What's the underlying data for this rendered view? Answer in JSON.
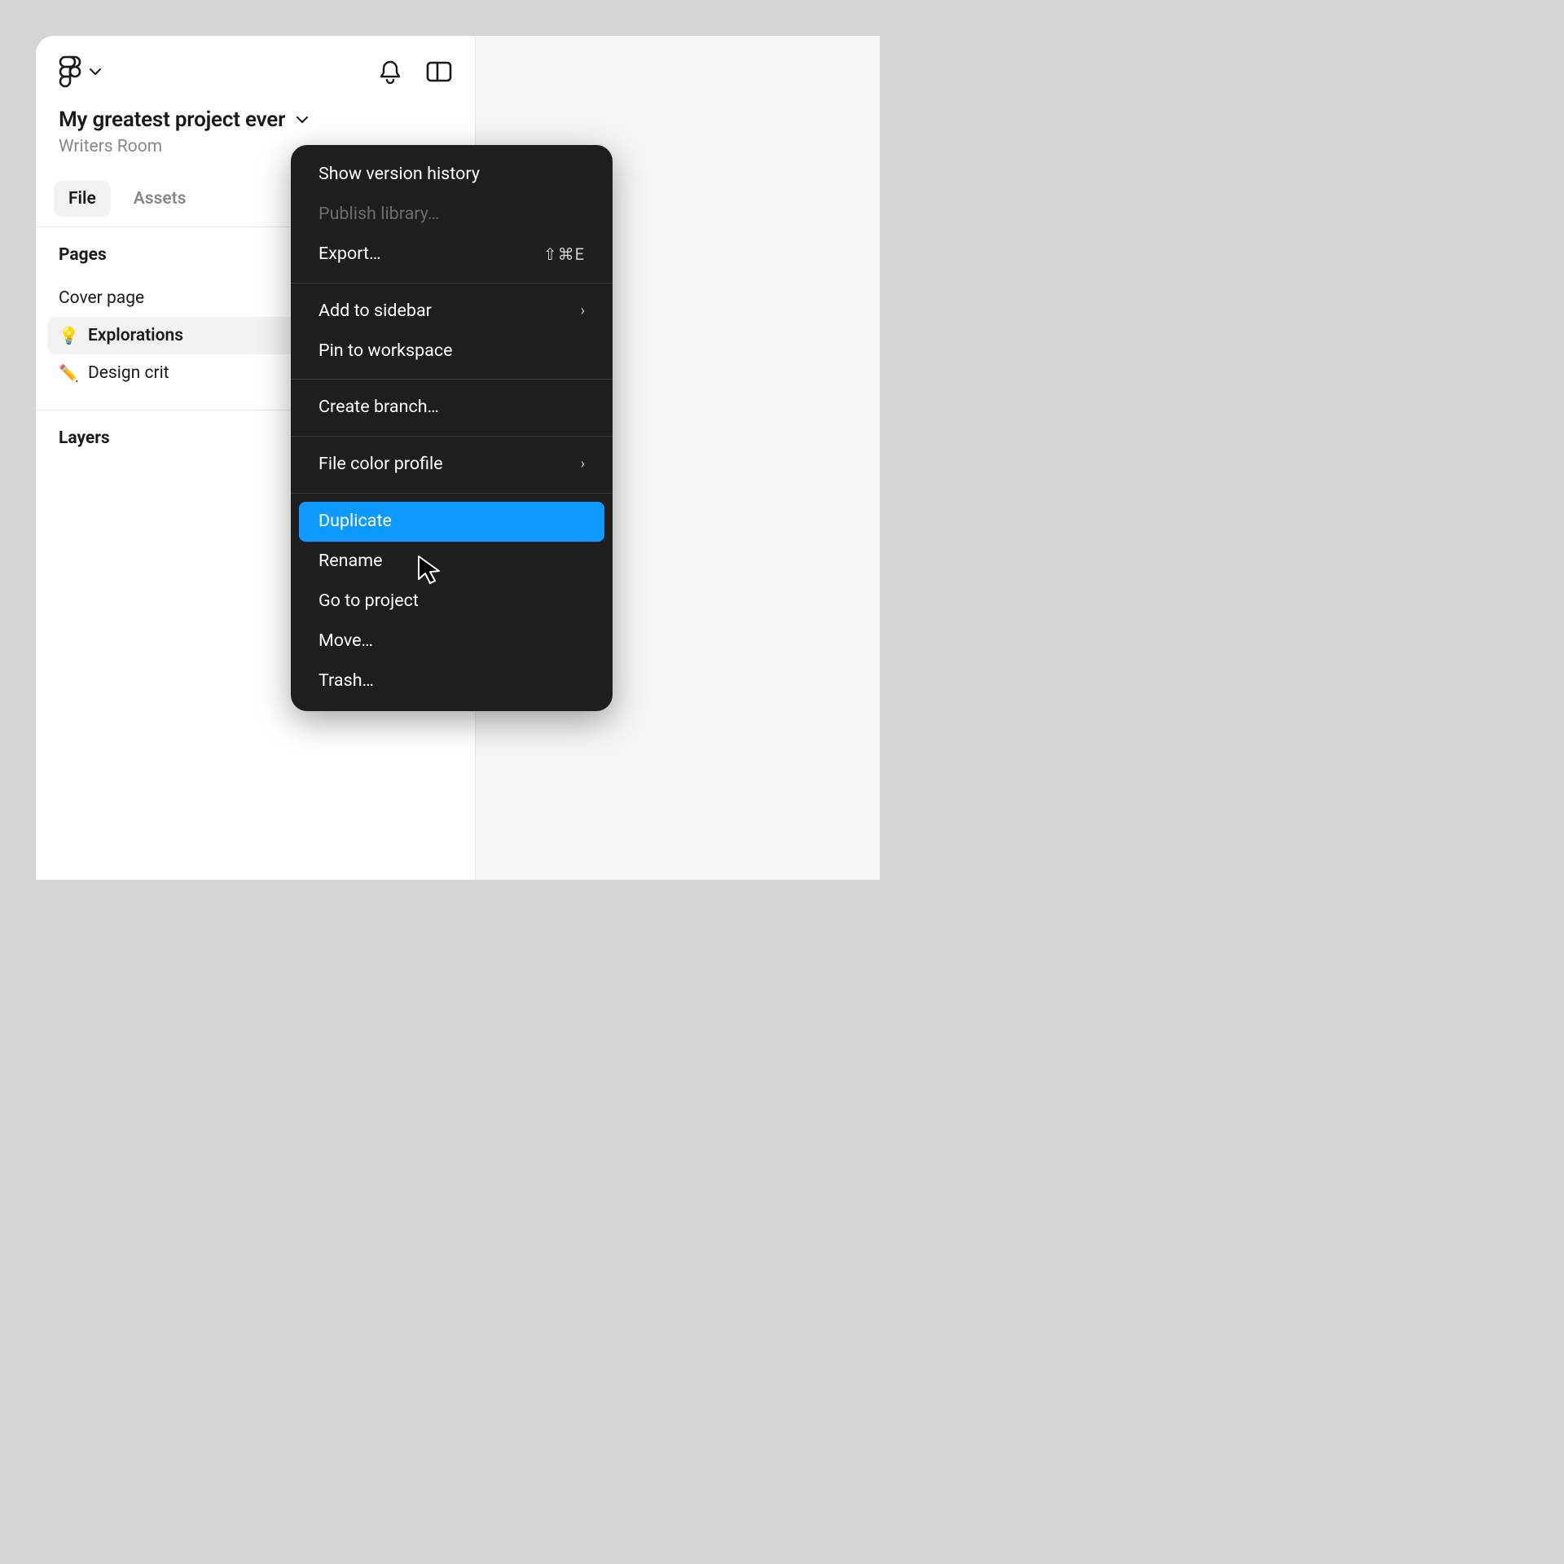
{
  "project": {
    "title": "My greatest project ever",
    "workspace": "Writers Room"
  },
  "tabs": {
    "file": "File",
    "assets": "Assets"
  },
  "pages": {
    "section_title": "Pages",
    "items": [
      {
        "emoji": "",
        "label": "Cover page",
        "active": false
      },
      {
        "emoji": "💡",
        "label": "Explorations",
        "active": true
      },
      {
        "emoji": "✏️",
        "label": "Design crit",
        "active": false
      }
    ]
  },
  "layers": {
    "section_title": "Layers"
  },
  "context_menu": {
    "groups": [
      [
        {
          "label": "Show version history",
          "shortcut": "",
          "submenu": false,
          "disabled": false,
          "hover": false
        },
        {
          "label": "Publish library…",
          "shortcut": "",
          "submenu": false,
          "disabled": true,
          "hover": false
        },
        {
          "label": "Export…",
          "shortcut": "⇧⌘E",
          "submenu": false,
          "disabled": false,
          "hover": false
        }
      ],
      [
        {
          "label": "Add to sidebar",
          "shortcut": "",
          "submenu": true,
          "disabled": false,
          "hover": false
        },
        {
          "label": "Pin to workspace",
          "shortcut": "",
          "submenu": false,
          "disabled": false,
          "hover": false
        }
      ],
      [
        {
          "label": "Create branch…",
          "shortcut": "",
          "submenu": false,
          "disabled": false,
          "hover": false
        }
      ],
      [
        {
          "label": "File color profile",
          "shortcut": "",
          "submenu": true,
          "disabled": false,
          "hover": false
        }
      ],
      [
        {
          "label": "Duplicate",
          "shortcut": "",
          "submenu": false,
          "disabled": false,
          "hover": true
        },
        {
          "label": "Rename",
          "shortcut": "",
          "submenu": false,
          "disabled": false,
          "hover": false
        },
        {
          "label": "Go to project",
          "shortcut": "",
          "submenu": false,
          "disabled": false,
          "hover": false
        },
        {
          "label": "Move…",
          "shortcut": "",
          "submenu": false,
          "disabled": false,
          "hover": false
        },
        {
          "label": "Trash…",
          "shortcut": "",
          "submenu": false,
          "disabled": false,
          "hover": false
        }
      ]
    ]
  }
}
